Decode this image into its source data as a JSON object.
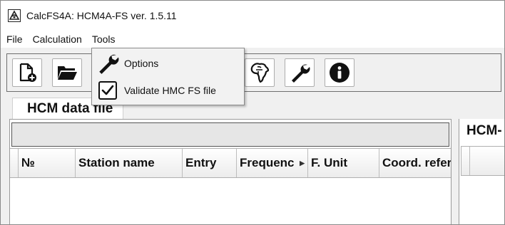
{
  "window": {
    "title": "CalcFS4A: HCM4A-FS ver. 1.5.11"
  },
  "menubar": {
    "items": [
      {
        "label": "File"
      },
      {
        "label": "Calculation"
      },
      {
        "label": "Tools"
      }
    ]
  },
  "tools_menu": {
    "items": [
      {
        "label": "Options",
        "icon": "wrench-icon"
      },
      {
        "label": "Validate HMC FS file",
        "icon": "checkbox-icon",
        "checked": true
      }
    ]
  },
  "toolbar": {
    "buttons": [
      {
        "icon": "new-file-icon"
      },
      {
        "icon": "open-folder-icon"
      },
      {
        "icon": "africa-map-icon"
      },
      {
        "icon": "wrench-icon"
      },
      {
        "icon": "info-icon"
      }
    ]
  },
  "tabs": [
    {
      "label": "HCM data file"
    }
  ],
  "table": {
    "columns": [
      {
        "label": "№"
      },
      {
        "label": "Station name"
      },
      {
        "label": "Entry"
      },
      {
        "label": "Frequenc"
      },
      {
        "label": "F. Unit"
      },
      {
        "label": "Coord. refer"
      }
    ]
  },
  "right_panel": {
    "title": "HCM-"
  }
}
